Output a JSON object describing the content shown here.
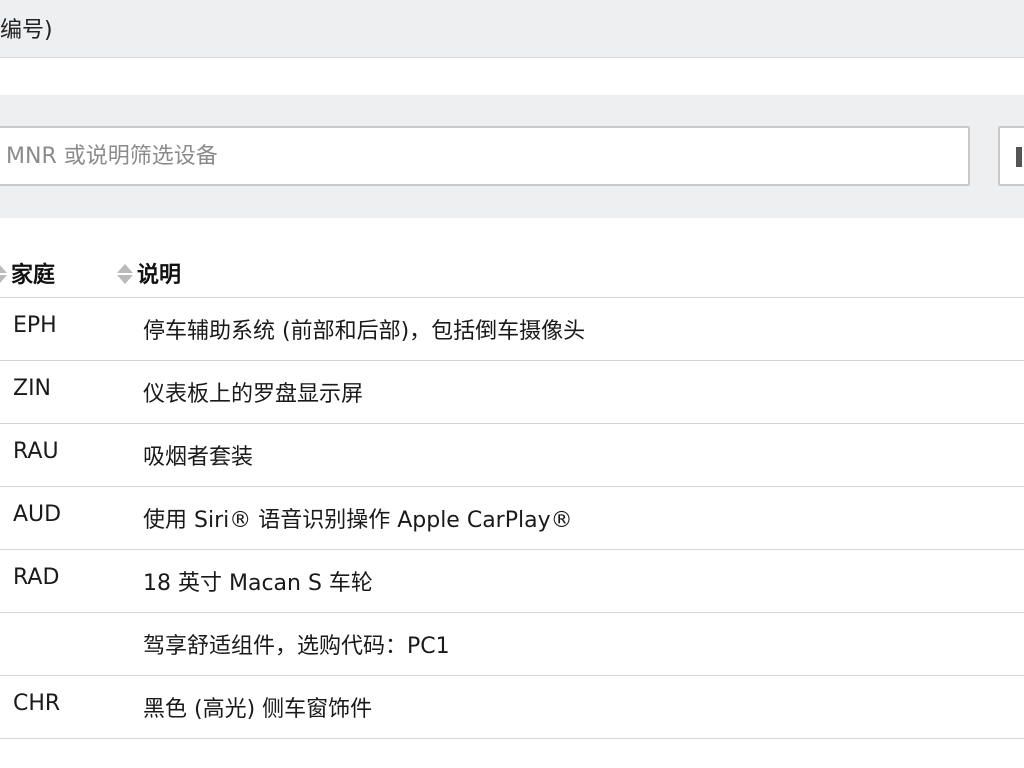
{
  "header": {
    "title_fragment": "编号)"
  },
  "filter": {
    "placeholder": "MNR 或说明筛选设备"
  },
  "table": {
    "columns": {
      "family": "家庭",
      "description": "说明"
    },
    "rows": [
      {
        "code": "EPH",
        "description": "停车辅助系统 (前部和后部)，包括倒车摄像头"
      },
      {
        "code": "ZIN",
        "description": "仪表板上的罗盘显示屏"
      },
      {
        "code": "RAU",
        "description": "吸烟者套装"
      },
      {
        "code": "AUD",
        "description": "使用 Siri® 语音识别操作 Apple CarPlay®"
      },
      {
        "code": "RAD",
        "description": "18 英寸 Macan S 车轮"
      },
      {
        "code": "",
        "description": "驾享舒适组件，选购代码：PC1"
      },
      {
        "code": "CHR",
        "description": "黑色 (高光) 侧车窗饰件"
      }
    ]
  },
  "icons": {
    "sort": "sort-icon"
  }
}
